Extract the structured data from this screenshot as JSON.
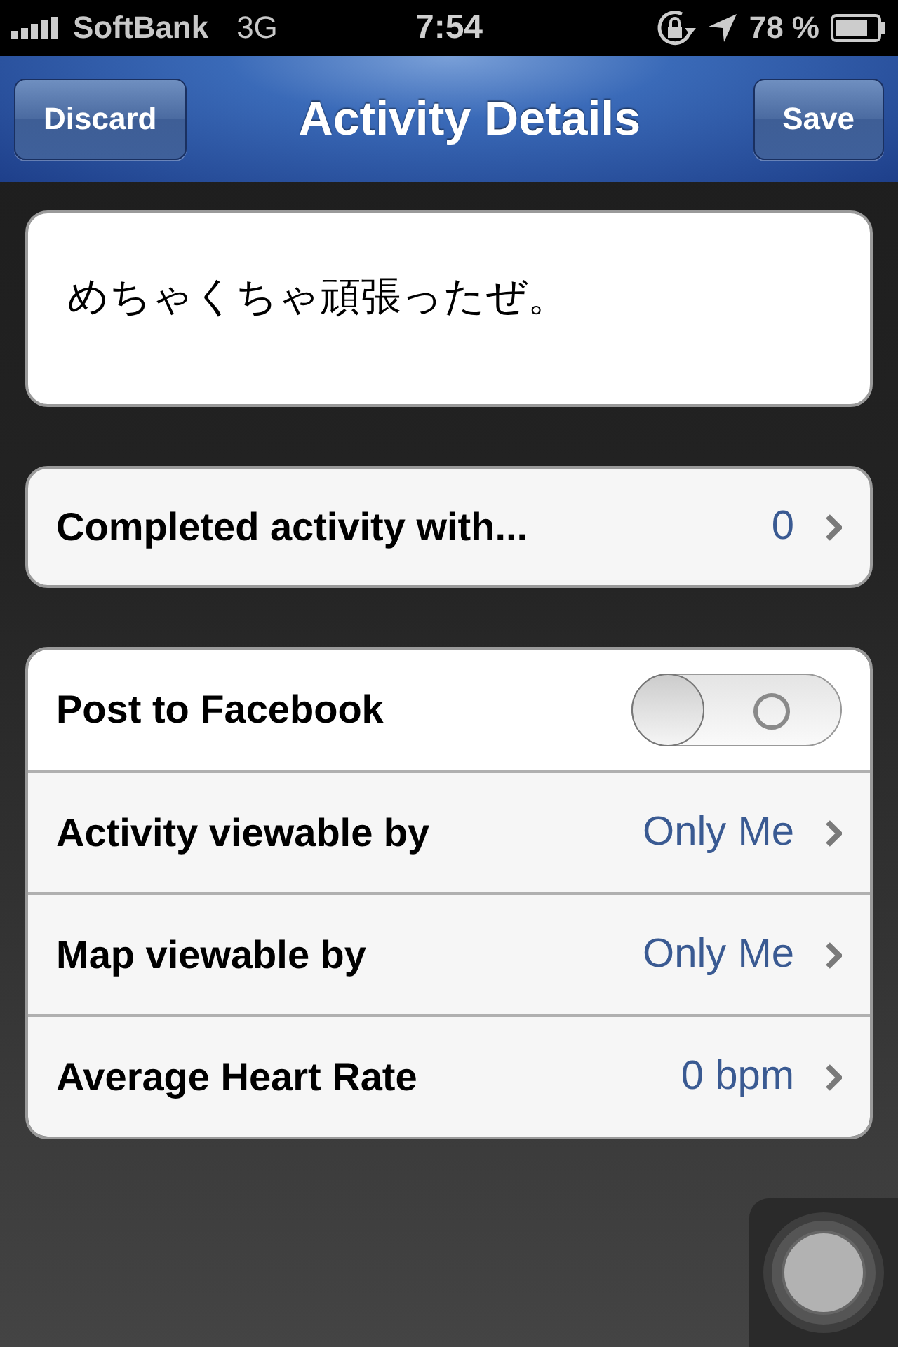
{
  "status_bar": {
    "carrier": "SoftBank",
    "network": "3G",
    "time": "7:54",
    "battery": "78 %"
  },
  "nav": {
    "title": "Activity Details",
    "left_button": "Discard",
    "right_button": "Save"
  },
  "note": {
    "value": "めちゃくちゃ頑張ったぜ。"
  },
  "companions": {
    "label": "Completed activity with...",
    "value": "0"
  },
  "settings": [
    {
      "kind": "toggle",
      "label": "Post to Facebook",
      "on": false
    },
    {
      "kind": "link",
      "label": "Activity viewable by",
      "value": "Only Me"
    },
    {
      "kind": "link",
      "label": "Map viewable by",
      "value": "Only Me"
    },
    {
      "kind": "link",
      "label": "Average Heart Rate",
      "value": "0 bpm"
    }
  ]
}
